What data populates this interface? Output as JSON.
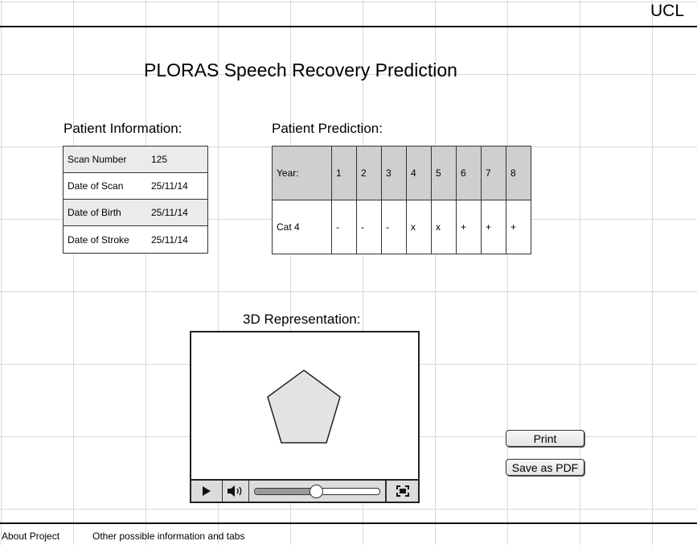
{
  "header": {
    "brand": "UCL",
    "title": "PLORAS Speech Recovery Prediction"
  },
  "patient_info": {
    "heading": "Patient Information:",
    "rows": [
      {
        "label": "Scan Number",
        "value": "125"
      },
      {
        "label": "Date of Scan",
        "value": "25/11/14"
      },
      {
        "label": "Date of Birth",
        "value": "25/11/14"
      },
      {
        "label": "Date of Stroke",
        "value": "25/11/14"
      }
    ]
  },
  "prediction": {
    "heading": "Patient Prediction:",
    "header_label": "Year:",
    "years": [
      "1",
      "2",
      "3",
      "4",
      "5",
      "6",
      "7",
      "8"
    ],
    "row_label": "Cat 4",
    "values": [
      "-",
      "-",
      "-",
      "x",
      "x",
      "+",
      "+",
      "+"
    ]
  },
  "representation": {
    "heading": "3D Representation:",
    "player": {
      "play_icon": "play-icon",
      "volume_icon": "volume-icon",
      "fullscreen_icon": "fullscreen-icon",
      "progress": 0.49
    }
  },
  "actions": {
    "print_label": "Print",
    "save_pdf_label": "Save as PDF"
  },
  "footer": {
    "about_label": "About Project",
    "other_label": "Other possible information and tabs"
  }
}
